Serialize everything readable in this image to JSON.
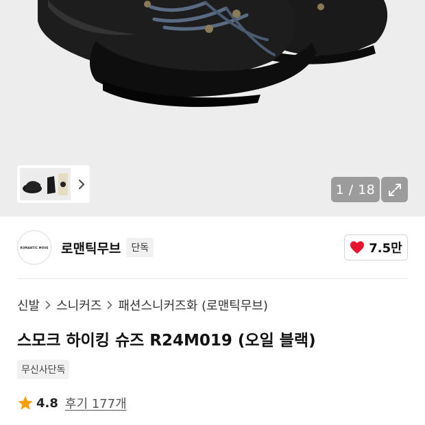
{
  "gallery": {
    "counter": "1 / 18",
    "bg_color": "#ededed",
    "icons": [
      "chevron-right-icon",
      "expand-icon"
    ]
  },
  "brand": {
    "logo_text": "ROMANTIC MOVE",
    "name": "로맨틱무브",
    "badge": "단독"
  },
  "like": {
    "count": "7.5만",
    "color": "#e8132c"
  },
  "breadcrumb": [
    "신발",
    "스니커즈",
    "패션스니커즈화 (로맨틱무브)"
  ],
  "product": {
    "title": "스모크 하이킹 슈즈 R24M019 (오일 블랙)",
    "tag": "무신사단독"
  },
  "rating": {
    "score": "4.8",
    "review_text": "후기 177개",
    "star_color": "#f5a00a"
  }
}
